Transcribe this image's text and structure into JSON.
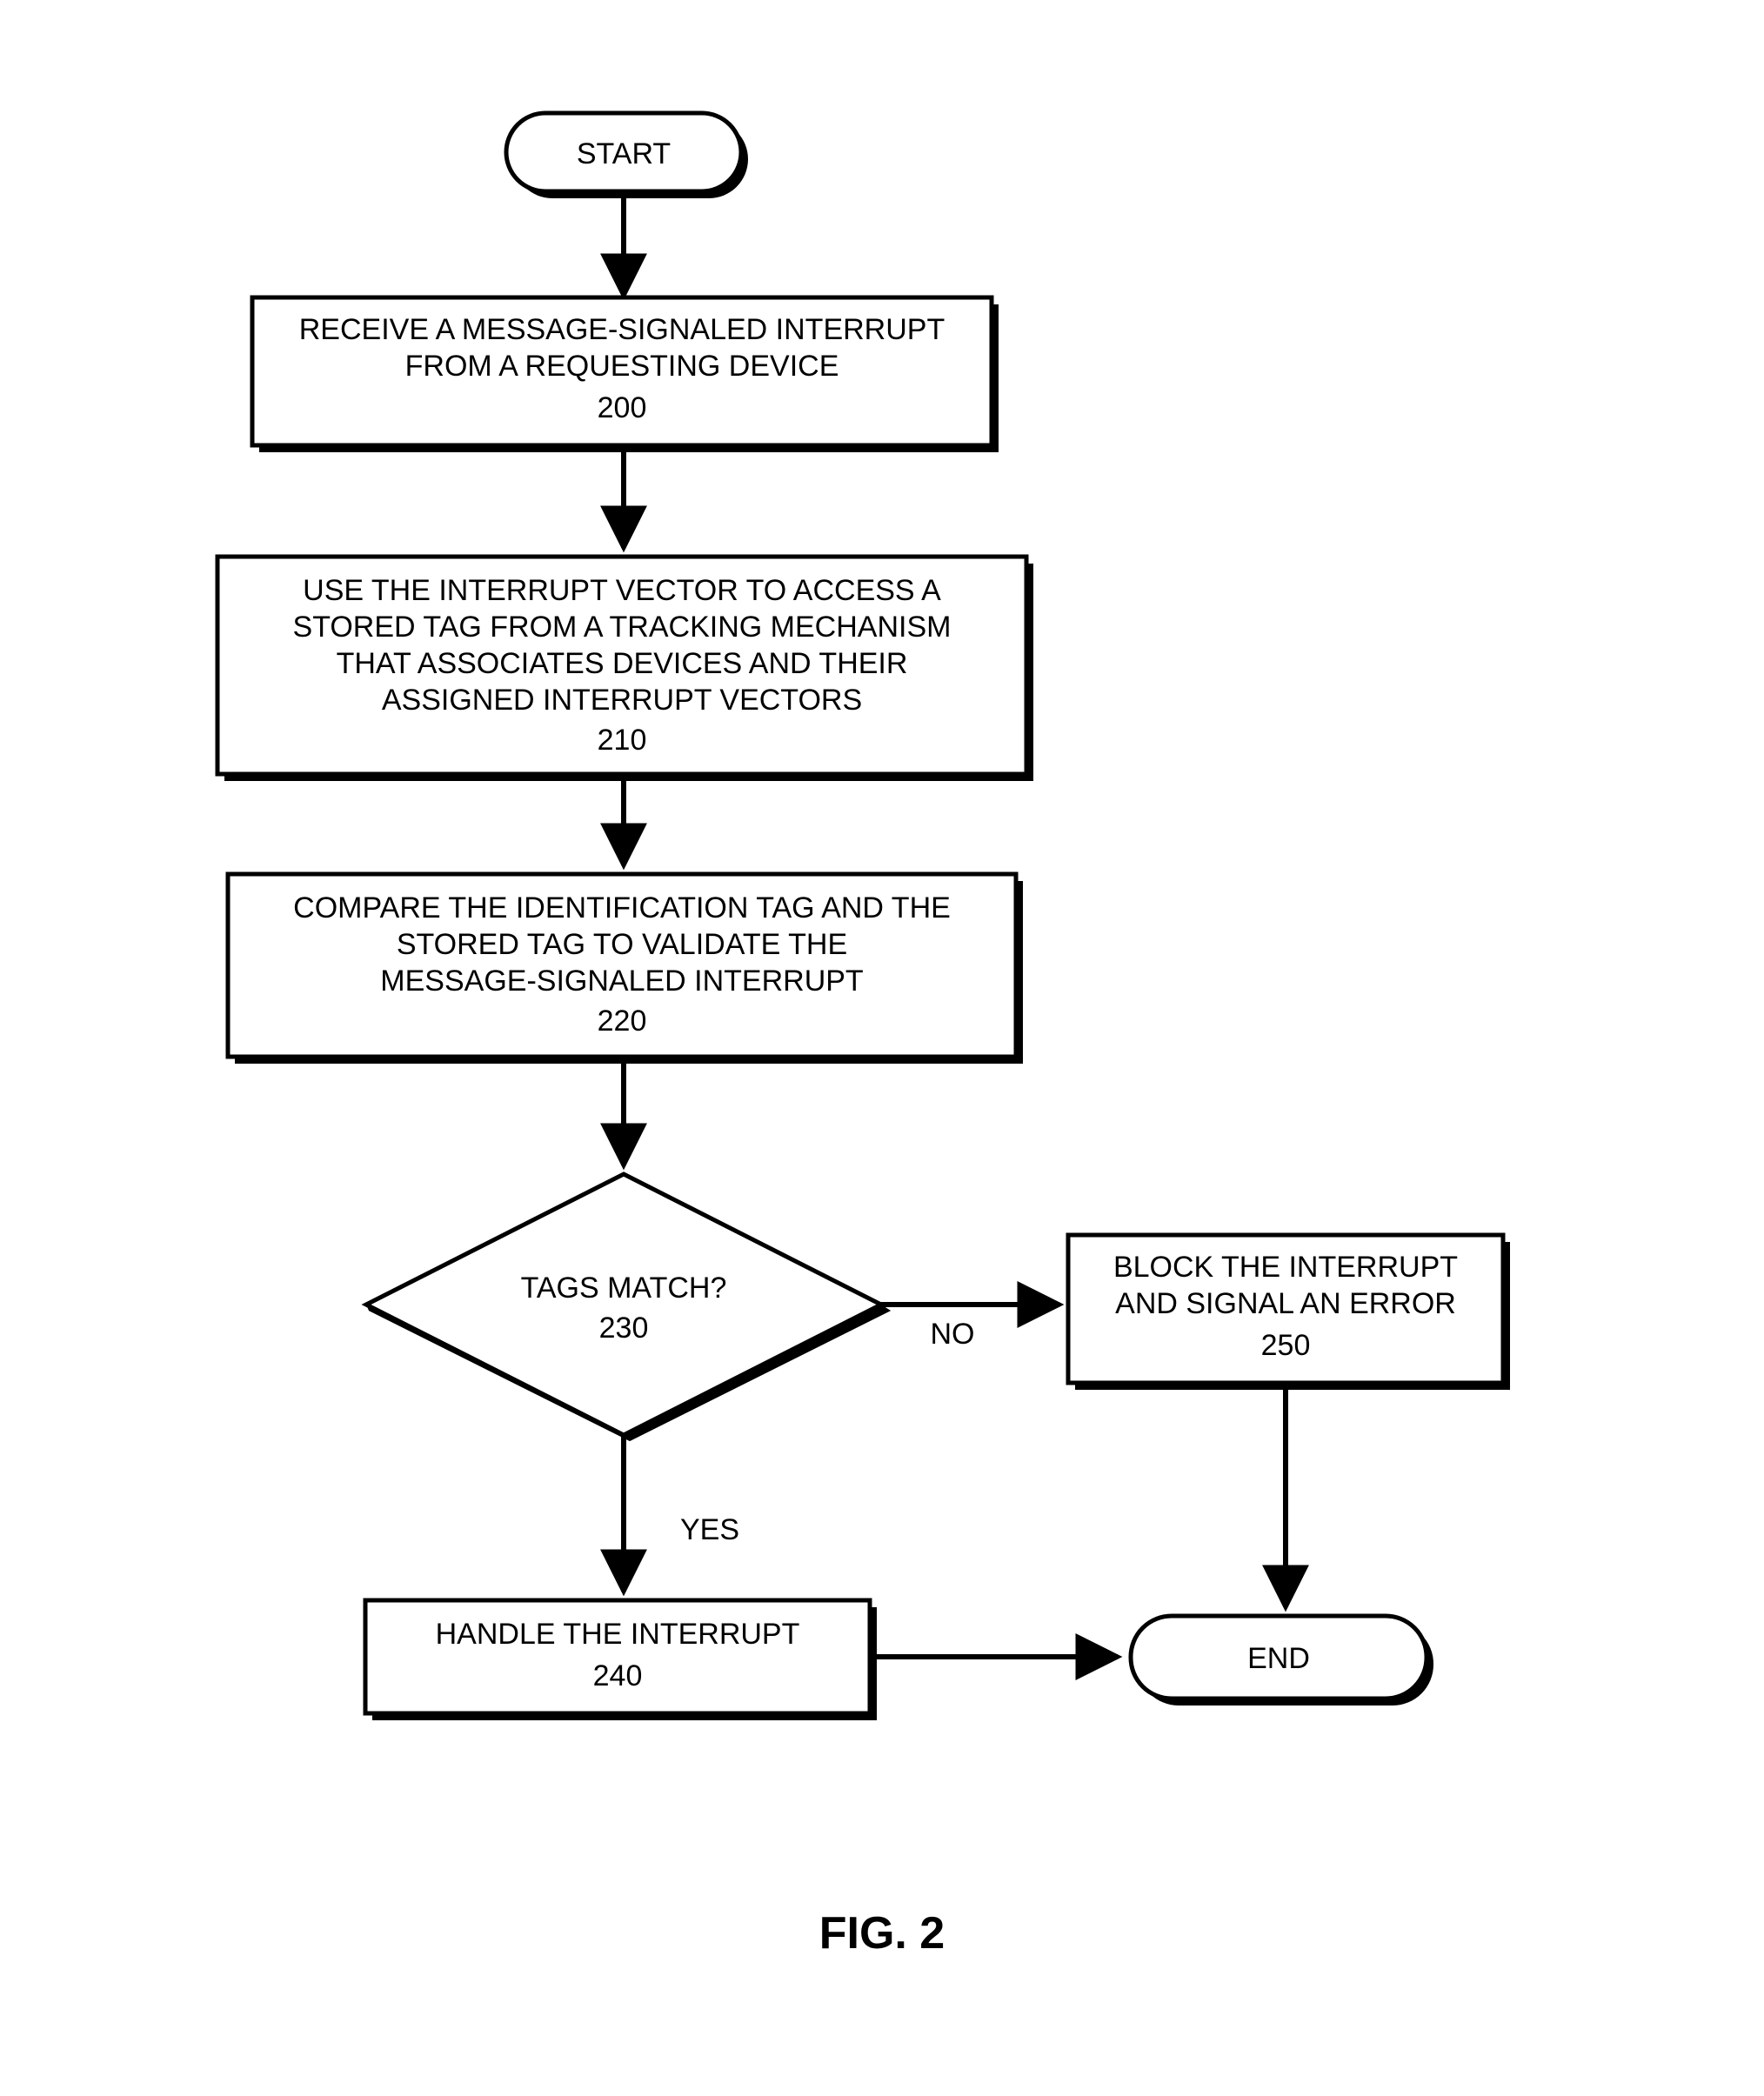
{
  "terminals": {
    "start": "START",
    "end": "END"
  },
  "steps": {
    "s200": {
      "l1": "RECEIVE A MESSAGE-SIGNALED INTERRUPT",
      "l2": "FROM A REQUESTING DEVICE",
      "num": "200"
    },
    "s210": {
      "l1": "USE THE INTERRUPT VECTOR TO ACCESS A",
      "l2": "STORED TAG FROM A TRACKING MECHANISM",
      "l3": "THAT ASSOCIATES DEVICES AND THEIR",
      "l4": "ASSIGNED INTERRUPT VECTORS",
      "num": "210"
    },
    "s220": {
      "l1": "COMPARE THE IDENTIFICATION TAG AND THE",
      "l2": "STORED TAG TO VALIDATE THE",
      "l3": "MESSAGE-SIGNALED INTERRUPT",
      "num": "220"
    },
    "s240": {
      "l1": "HANDLE THE INTERRUPT",
      "num": "240"
    },
    "s250": {
      "l1": "BLOCK THE INTERRUPT",
      "l2": "AND SIGNAL AN ERROR",
      "num": "250"
    }
  },
  "decision": {
    "q": "TAGS MATCH?",
    "num": "230"
  },
  "labels": {
    "yes": "YES",
    "no": "NO"
  },
  "figure": "FIG. 2"
}
